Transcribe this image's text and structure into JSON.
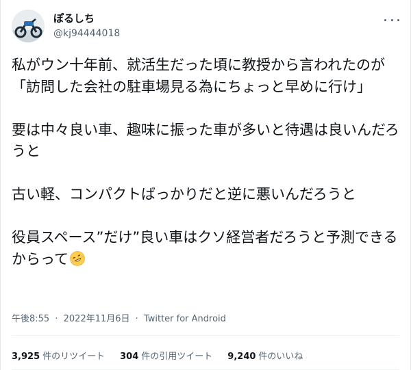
{
  "tweet": {
    "author": {
      "display_name": "ぽるしち",
      "handle": "@kj94444018"
    },
    "text": "私がウン十年前、就活生だった頃に教授から言われたのが\n「訪問した会社の駐車場見る為にちょっと早めに行け」\n\n要は中々良い車、趣味に振った車が多いと待遇は良いんだろうと\n\n古い軽、コンパクトばっかりだと逆に悪いんだろうと\n\n役員スペース”だけ”良い車はクソ経営者だろうと予測できるからって",
    "emoji": "rolling-on-floor-laughing",
    "time": "午後8:55",
    "date": "2022年11月6日",
    "source": "Twitter for Android",
    "separator": "·"
  },
  "stats": {
    "retweets": {
      "count": "3,925",
      "label": "件のリツイート"
    },
    "quotes": {
      "count": "304",
      "label": "件の引用ツイート"
    },
    "likes": {
      "count": "9,240",
      "label": "件のいいね"
    }
  },
  "icons": [
    "avatar",
    "more-icon",
    "rolling-laughing-emoji"
  ],
  "colors": {
    "text": "#0f1419",
    "secondary": "#536471",
    "divider": "#eff3f4"
  }
}
